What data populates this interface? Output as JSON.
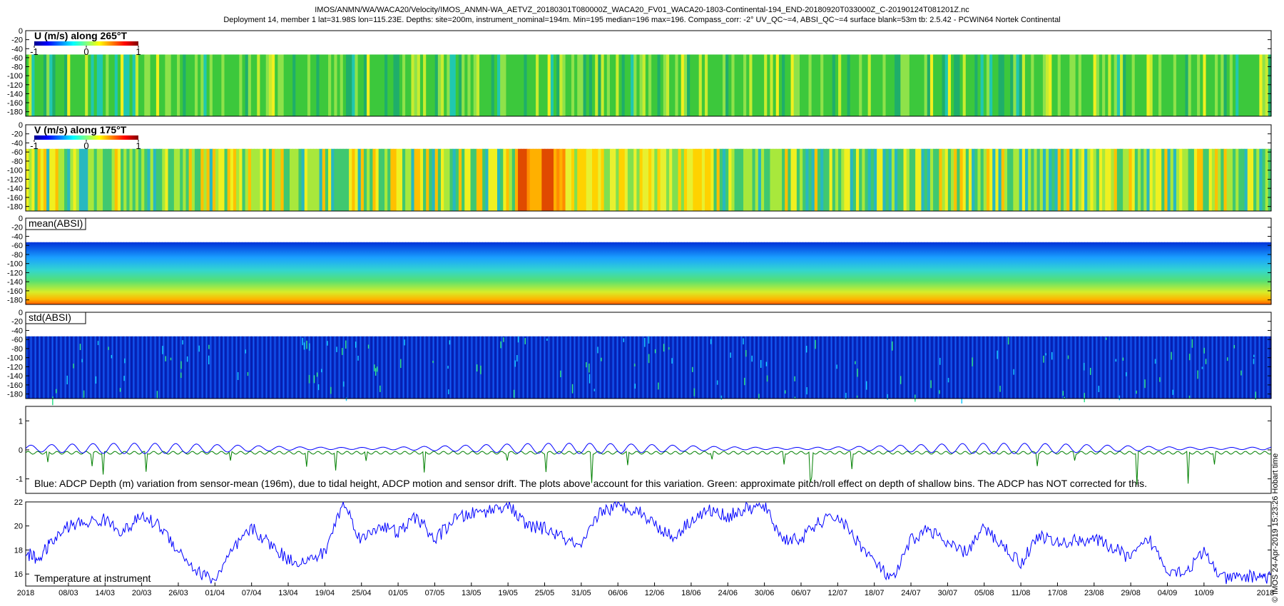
{
  "header": {
    "line1": "IMOS/ANMN/WA/WACA20/Velocity/IMOS_ANMN-WA_AETVZ_20180301T080000Z_WACA20_FV01_WACA20-1803-Continental-194_END-20180920T033000Z_C-20190124T081201Z.nc",
    "line2": "Deployment 14, member 1 lat=31.98S lon=115.23E. Depths: site=200m, instrument_nominal=194m. Min=195 median=196 max=196. Compass_corr: -2° UV_QC~=4, ABSI_QC~=4 surface blank=53m tb: 2.5.42 - PCWIN64 Nortek Continental"
  },
  "side_label": "© IMOS 24-Apr-2019 15:23:26 Hobart time",
  "colors": {
    "depth_line": "#0000ff",
    "pitchroll_line": "#008000",
    "temperature_line": "#0000ff",
    "colormap": [
      "#00008f",
      "#0000ff",
      "#0080ff",
      "#00ffff",
      "#80ff80",
      "#ffff00",
      "#ff8000",
      "#ff0000",
      "#800000"
    ]
  },
  "chart_data": [
    {
      "type": "heatmap",
      "title": "U (m/s) along 265°T",
      "colorbar_ticks": [
        "-1",
        "0",
        "1"
      ],
      "clim": [
        -1,
        1
      ],
      "y_ticks": [
        "0",
        "-20",
        "-40",
        "-60",
        "-80",
        "-100",
        "-120",
        "-140",
        "-160",
        "-180"
      ],
      "ylim": [
        -190,
        0
      ],
      "surface_blank_depth": -53,
      "dominant_value": 0.0
    },
    {
      "type": "heatmap",
      "title": "V (m/s) along 175°T",
      "colorbar_ticks": [
        "-1",
        "0",
        "1"
      ],
      "clim": [
        -1,
        1
      ],
      "y_ticks": [
        "0",
        "-20",
        "-40",
        "-60",
        "-80",
        "-100",
        "-120",
        "-140",
        "-160",
        "-180"
      ],
      "ylim": [
        -190,
        0
      ],
      "surface_blank_depth": -53,
      "strong_positive_period": [
        "19/05",
        "27/05"
      ]
    },
    {
      "type": "heatmap",
      "title": "mean(ABSI)",
      "y_ticks": [
        "0",
        "-20",
        "-40",
        "-60",
        "-80",
        "-100",
        "-120",
        "-140",
        "-160",
        "-180"
      ],
      "ylim": [
        -190,
        0
      ],
      "surface_blank_depth": -53,
      "gradient": "low near surface, high near bottom"
    },
    {
      "type": "heatmap",
      "title": "std(ABSI)",
      "y_ticks": [
        "0",
        "-20",
        "-40",
        "-60",
        "-80",
        "-100",
        "-120",
        "-140",
        "-160",
        "-180"
      ],
      "ylim": [
        -190,
        0
      ],
      "surface_blank_depth": -53,
      "gradient": "uniformly low"
    },
    {
      "type": "line",
      "y_ticks": [
        "1",
        "0",
        "-1"
      ],
      "ylim": [
        -1.5,
        1.5
      ],
      "annotation": "Blue: ADCP Depth (m) variation from sensor-mean (196m), due to tidal height, ADCP motion and sensor drift. The plots above account for this variation. Green: approximate pitch/roll effect on depth of shallow bins. The ADCP has NOT corrected for this.",
      "series": [
        {
          "color": "blue",
          "description": "tidal oscillation amplitude ~0.2m around 0"
        },
        {
          "color": "green",
          "description": "near -0.1 with downward spikes to -1.2"
        }
      ]
    },
    {
      "type": "line",
      "y_ticks": [
        "22",
        "20",
        "18",
        "16"
      ],
      "ylim": [
        15,
        22
      ],
      "annotation": "Temperature at instrument",
      "x_label_left": "2018",
      "x_label_right": "2018",
      "x_ticks": [
        "08/03",
        "14/03",
        "20/03",
        "26/03",
        "01/04",
        "07/04",
        "13/04",
        "19/04",
        "25/04",
        "01/05",
        "07/05",
        "13/05",
        "19/05",
        "25/05",
        "31/05",
        "06/06",
        "12/06",
        "18/06",
        "24/06",
        "30/06",
        "06/07",
        "12/07",
        "18/07",
        "24/07",
        "30/07",
        "05/08",
        "11/08",
        "17/08",
        "23/08",
        "29/08",
        "04/09",
        "10/09"
      ],
      "xlim_days": [
        0,
        204
      ],
      "series": [
        {
          "x_days": [
            0,
            2,
            4,
            7,
            10,
            13,
            16,
            19,
            22,
            25,
            28,
            31,
            34,
            37,
            40,
            43,
            46,
            49,
            52,
            55,
            58,
            61,
            64,
            67,
            70,
            73,
            76,
            79,
            82,
            85,
            88,
            91,
            94,
            97,
            100,
            103,
            106,
            109,
            112,
            115,
            118,
            121,
            124,
            127,
            130,
            133,
            136,
            139,
            142,
            145,
            148,
            151,
            154,
            157,
            160,
            163,
            166,
            169,
            172,
            175,
            178,
            181,
            184,
            187,
            190,
            193,
            196,
            199,
            202,
            204
          ],
          "temperature": [
            17.8,
            17.2,
            18.5,
            20.0,
            20.3,
            20.5,
            19.5,
            20.8,
            20.0,
            18.0,
            16.2,
            15.5,
            18.0,
            19.8,
            18.5,
            17.2,
            17.0,
            17.8,
            22.0,
            18.8,
            20.1,
            19.4,
            20.8,
            18.8,
            20.5,
            21.0,
            21.3,
            21.8,
            20.0,
            19.8,
            19.0,
            18.1,
            21.2,
            21.6,
            21.4,
            20.2,
            19.0,
            20.5,
            21.3,
            20.8,
            21.4,
            21.6,
            18.9,
            18.9,
            20.3,
            20.8,
            18.9,
            17.0,
            15.4,
            18.8,
            19.8,
            18.4,
            17.8,
            19.8,
            18.4,
            16.9,
            19.3,
            18.5,
            18.8,
            18.9,
            18.2,
            17.3,
            18.9,
            16.4,
            16.2,
            17.8,
            15.6,
            15.7,
            15.9,
            15.6
          ]
        }
      ]
    }
  ]
}
